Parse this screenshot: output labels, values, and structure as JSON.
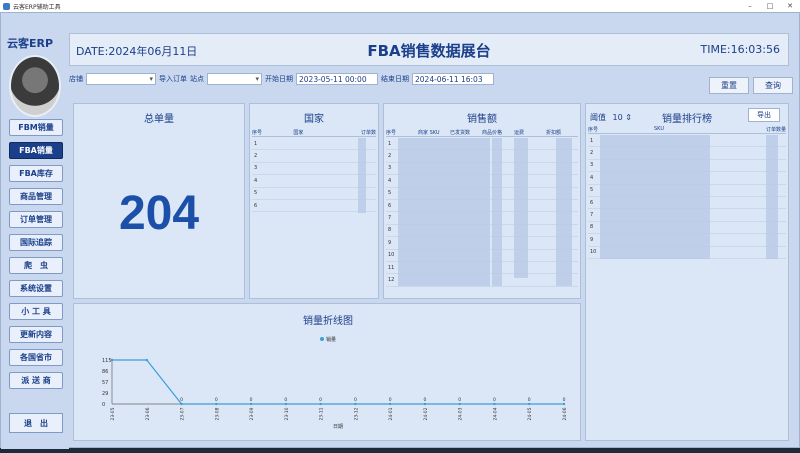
{
  "window": {
    "title": "云客ERP辅助工具",
    "minimize": "–",
    "maximize": "□",
    "close": "✕"
  },
  "sidebar": {
    "brand": "云客ERP",
    "items": [
      {
        "label": "FBM销量"
      },
      {
        "label": "FBA销量"
      },
      {
        "label": "FBA库存"
      },
      {
        "label": "商品管理"
      },
      {
        "label": "订单管理"
      },
      {
        "label": "国际追踪"
      },
      {
        "label": "爬　虫"
      },
      {
        "label": "系统设置"
      },
      {
        "label": "小 工 具"
      },
      {
        "label": "更新内容"
      },
      {
        "label": "各国省市"
      },
      {
        "label": "派 送 商"
      }
    ],
    "exit_label": "退　出"
  },
  "header": {
    "date": "DATE:2024年06月11日",
    "title": "FBA销售数据展台",
    "time": "TIME:16:03:56"
  },
  "filters": {
    "shop_label": "店铺",
    "import_label": "导入订单",
    "site_label": "站点",
    "start_label": "开始日期",
    "start_value": "2023-05-11 00:00",
    "end_label": "结束日期",
    "end_value": "2024-06-11 16:03",
    "reset_label": "重置",
    "query_label": "查询"
  },
  "total_orders": {
    "title": "总单量",
    "value": "204"
  },
  "country": {
    "title": "国家",
    "columns": [
      "序号",
      "国家",
      "订单数"
    ],
    "rows": [
      "1",
      "2",
      "3",
      "4",
      "5",
      "6"
    ]
  },
  "sales": {
    "title": "销售额",
    "columns": [
      "序号",
      "商家 SKU",
      "已发货数",
      "商品价格",
      "运费",
      "折扣额"
    ],
    "rows": [
      "1",
      "2",
      "3",
      "4",
      "5",
      "6",
      "7",
      "8",
      "9",
      "10",
      "11",
      "12"
    ]
  },
  "ranking": {
    "title": "销量排行榜",
    "threshold_label": "阈值",
    "threshold_value": "10",
    "export_label": "导出",
    "columns": [
      "序号",
      "SKU",
      "订单数量"
    ],
    "rows": [
      "1",
      "2",
      "3",
      "4",
      "5",
      "6",
      "7",
      "8",
      "9",
      "10"
    ]
  },
  "chart_data": {
    "type": "line",
    "title": "销量折线图",
    "series": [
      {
        "name": "销量",
        "values": [
          115,
          115,
          0,
          0,
          0,
          0,
          0,
          0,
          0,
          0,
          0,
          0,
          0,
          0
        ]
      }
    ],
    "categories": [
      "23-05",
      "23-06",
      "23-07",
      "23-08",
      "23-09",
      "23-10",
      "23-11",
      "23-12",
      "24-01",
      "24-02",
      "24-03",
      "24-04",
      "24-05",
      "24-06"
    ],
    "yticks": [
      "115",
      "86",
      "57",
      "29",
      "0"
    ],
    "xlabel": "日期",
    "ylabel": "",
    "ylim": [
      0,
      115
    ],
    "color": "#3aa0d8"
  }
}
